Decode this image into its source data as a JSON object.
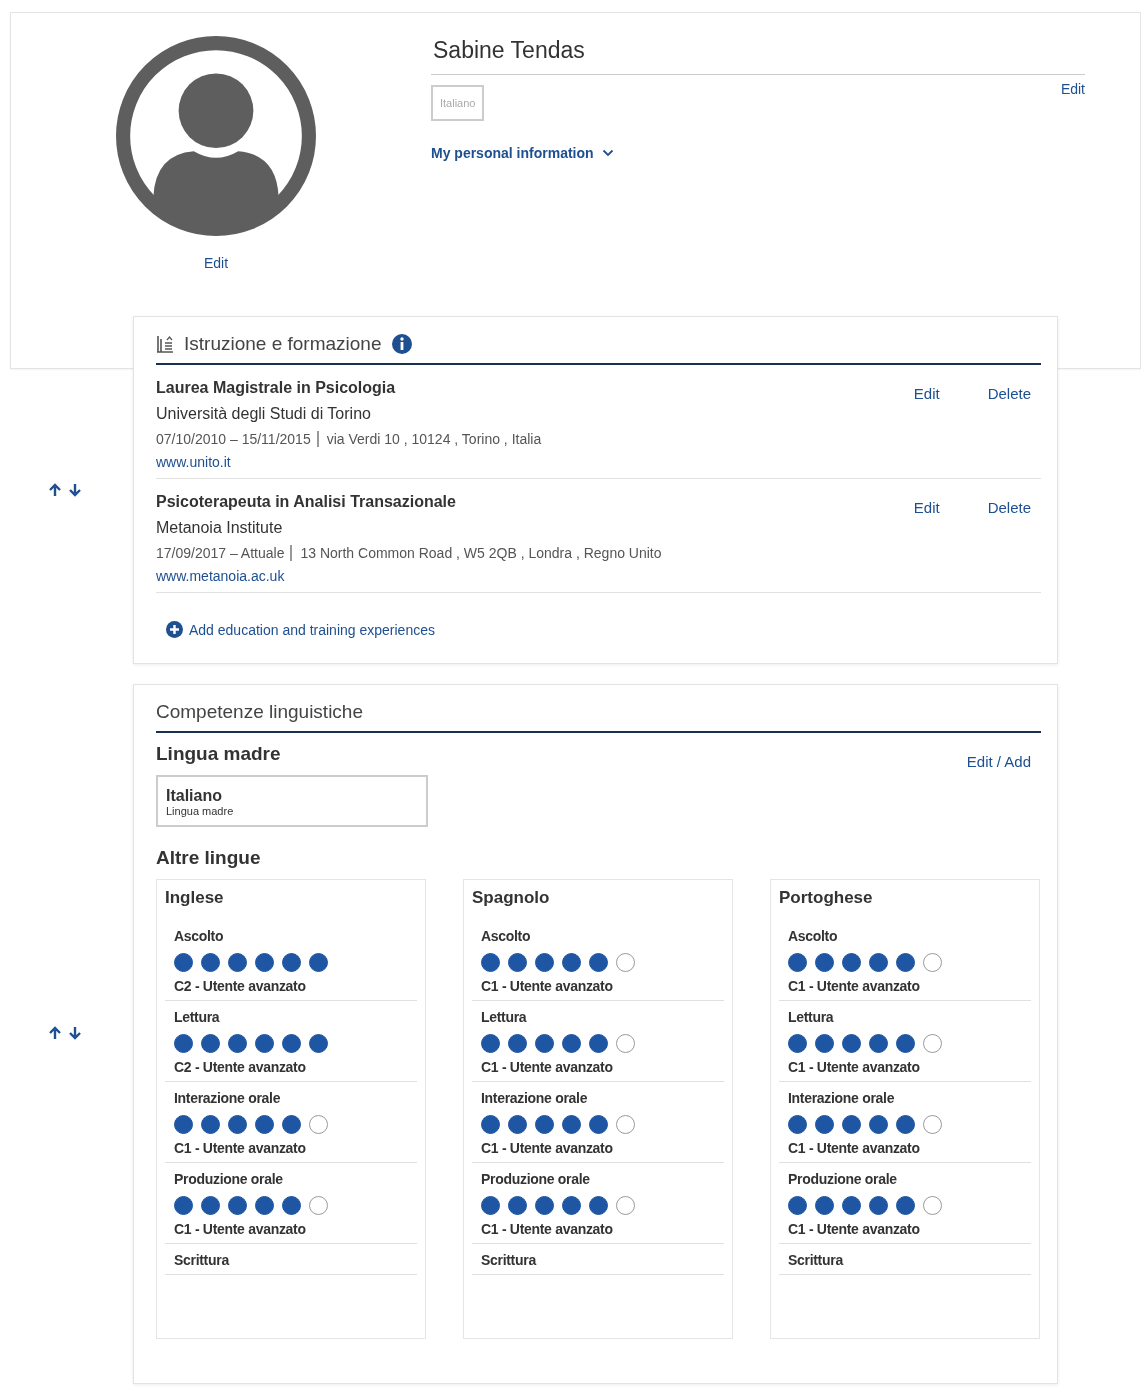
{
  "profile": {
    "name": "Sabine Tendas",
    "language_tag": "Italiano",
    "edit_link": "Edit",
    "personal_info_toggle": {
      "label": "My personal information",
      "expanded": false
    },
    "photo_edit_link": "Edit"
  },
  "education": {
    "title": "Istruzione e formazione",
    "entries": [
      {
        "title": "Laurea Magistrale in Psicologia",
        "institution": "Università degli Studi di Torino",
        "dates": "07/10/2010 – 15/11/2015",
        "address": "via Verdi 10 , 10124 , Torino , Italia",
        "website": "www.unito.it",
        "edit": "Edit",
        "delete": "Delete"
      },
      {
        "title": "Psicoterapeuta in Analisi Transazionale",
        "institution": "Metanoia Institute",
        "dates": "17/09/2017 – Attuale",
        "address": "13 North Common Road , W5 2QB , Londra , Regno Unito",
        "website": "www.metanoia.ac.uk",
        "edit": "Edit",
        "delete": "Delete"
      }
    ],
    "add_link": "Add education and training experiences"
  },
  "languages": {
    "title": "Competenze linguistiche",
    "mother_heading": "Lingua madre",
    "edit_add": "Edit / Add",
    "mother_tongue": {
      "name": "Italiano",
      "caption": "Lingua madre"
    },
    "other_heading": "Altre lingue",
    "others": [
      {
        "name": "Inglese",
        "skills": [
          {
            "label": "Ascolto",
            "stars": 6,
            "level_text": "C2 - Utente avanzato"
          },
          {
            "label": "Lettura",
            "stars": 6,
            "level_text": "C2 - Utente avanzato"
          },
          {
            "label": "Interazione orale",
            "stars": 5,
            "level_text": "C1 - Utente avanzato"
          },
          {
            "label": "Produzione orale",
            "stars": 5,
            "level_text": "C1 - Utente avanzato"
          },
          {
            "label": "Scrittura"
          }
        ]
      },
      {
        "name": "Spagnolo",
        "skills": [
          {
            "label": "Ascolto",
            "stars": 5,
            "level_text": "C1 - Utente avanzato"
          },
          {
            "label": "Lettura",
            "stars": 5,
            "level_text": "C1 - Utente avanzato"
          },
          {
            "label": "Interazione orale",
            "stars": 5,
            "level_text": "C1 - Utente avanzato"
          },
          {
            "label": "Produzione orale",
            "stars": 5,
            "level_text": "C1 - Utente avanzato"
          },
          {
            "label": "Scrittura"
          }
        ]
      },
      {
        "name": "Portoghese",
        "skills": [
          {
            "label": "Ascolto",
            "stars": 5,
            "level_text": "C1 - Utente avanzato"
          },
          {
            "label": "Lettura",
            "stars": 5,
            "level_text": "C1 - Utente avanzato"
          },
          {
            "label": "Interazione orale",
            "stars": 5,
            "level_text": "C1 - Utente avanzato"
          },
          {
            "label": "Produzione orale",
            "stars": 5,
            "level_text": "C1 - Utente avanzato"
          },
          {
            "label": "Scrittura"
          }
        ]
      }
    ]
  }
}
